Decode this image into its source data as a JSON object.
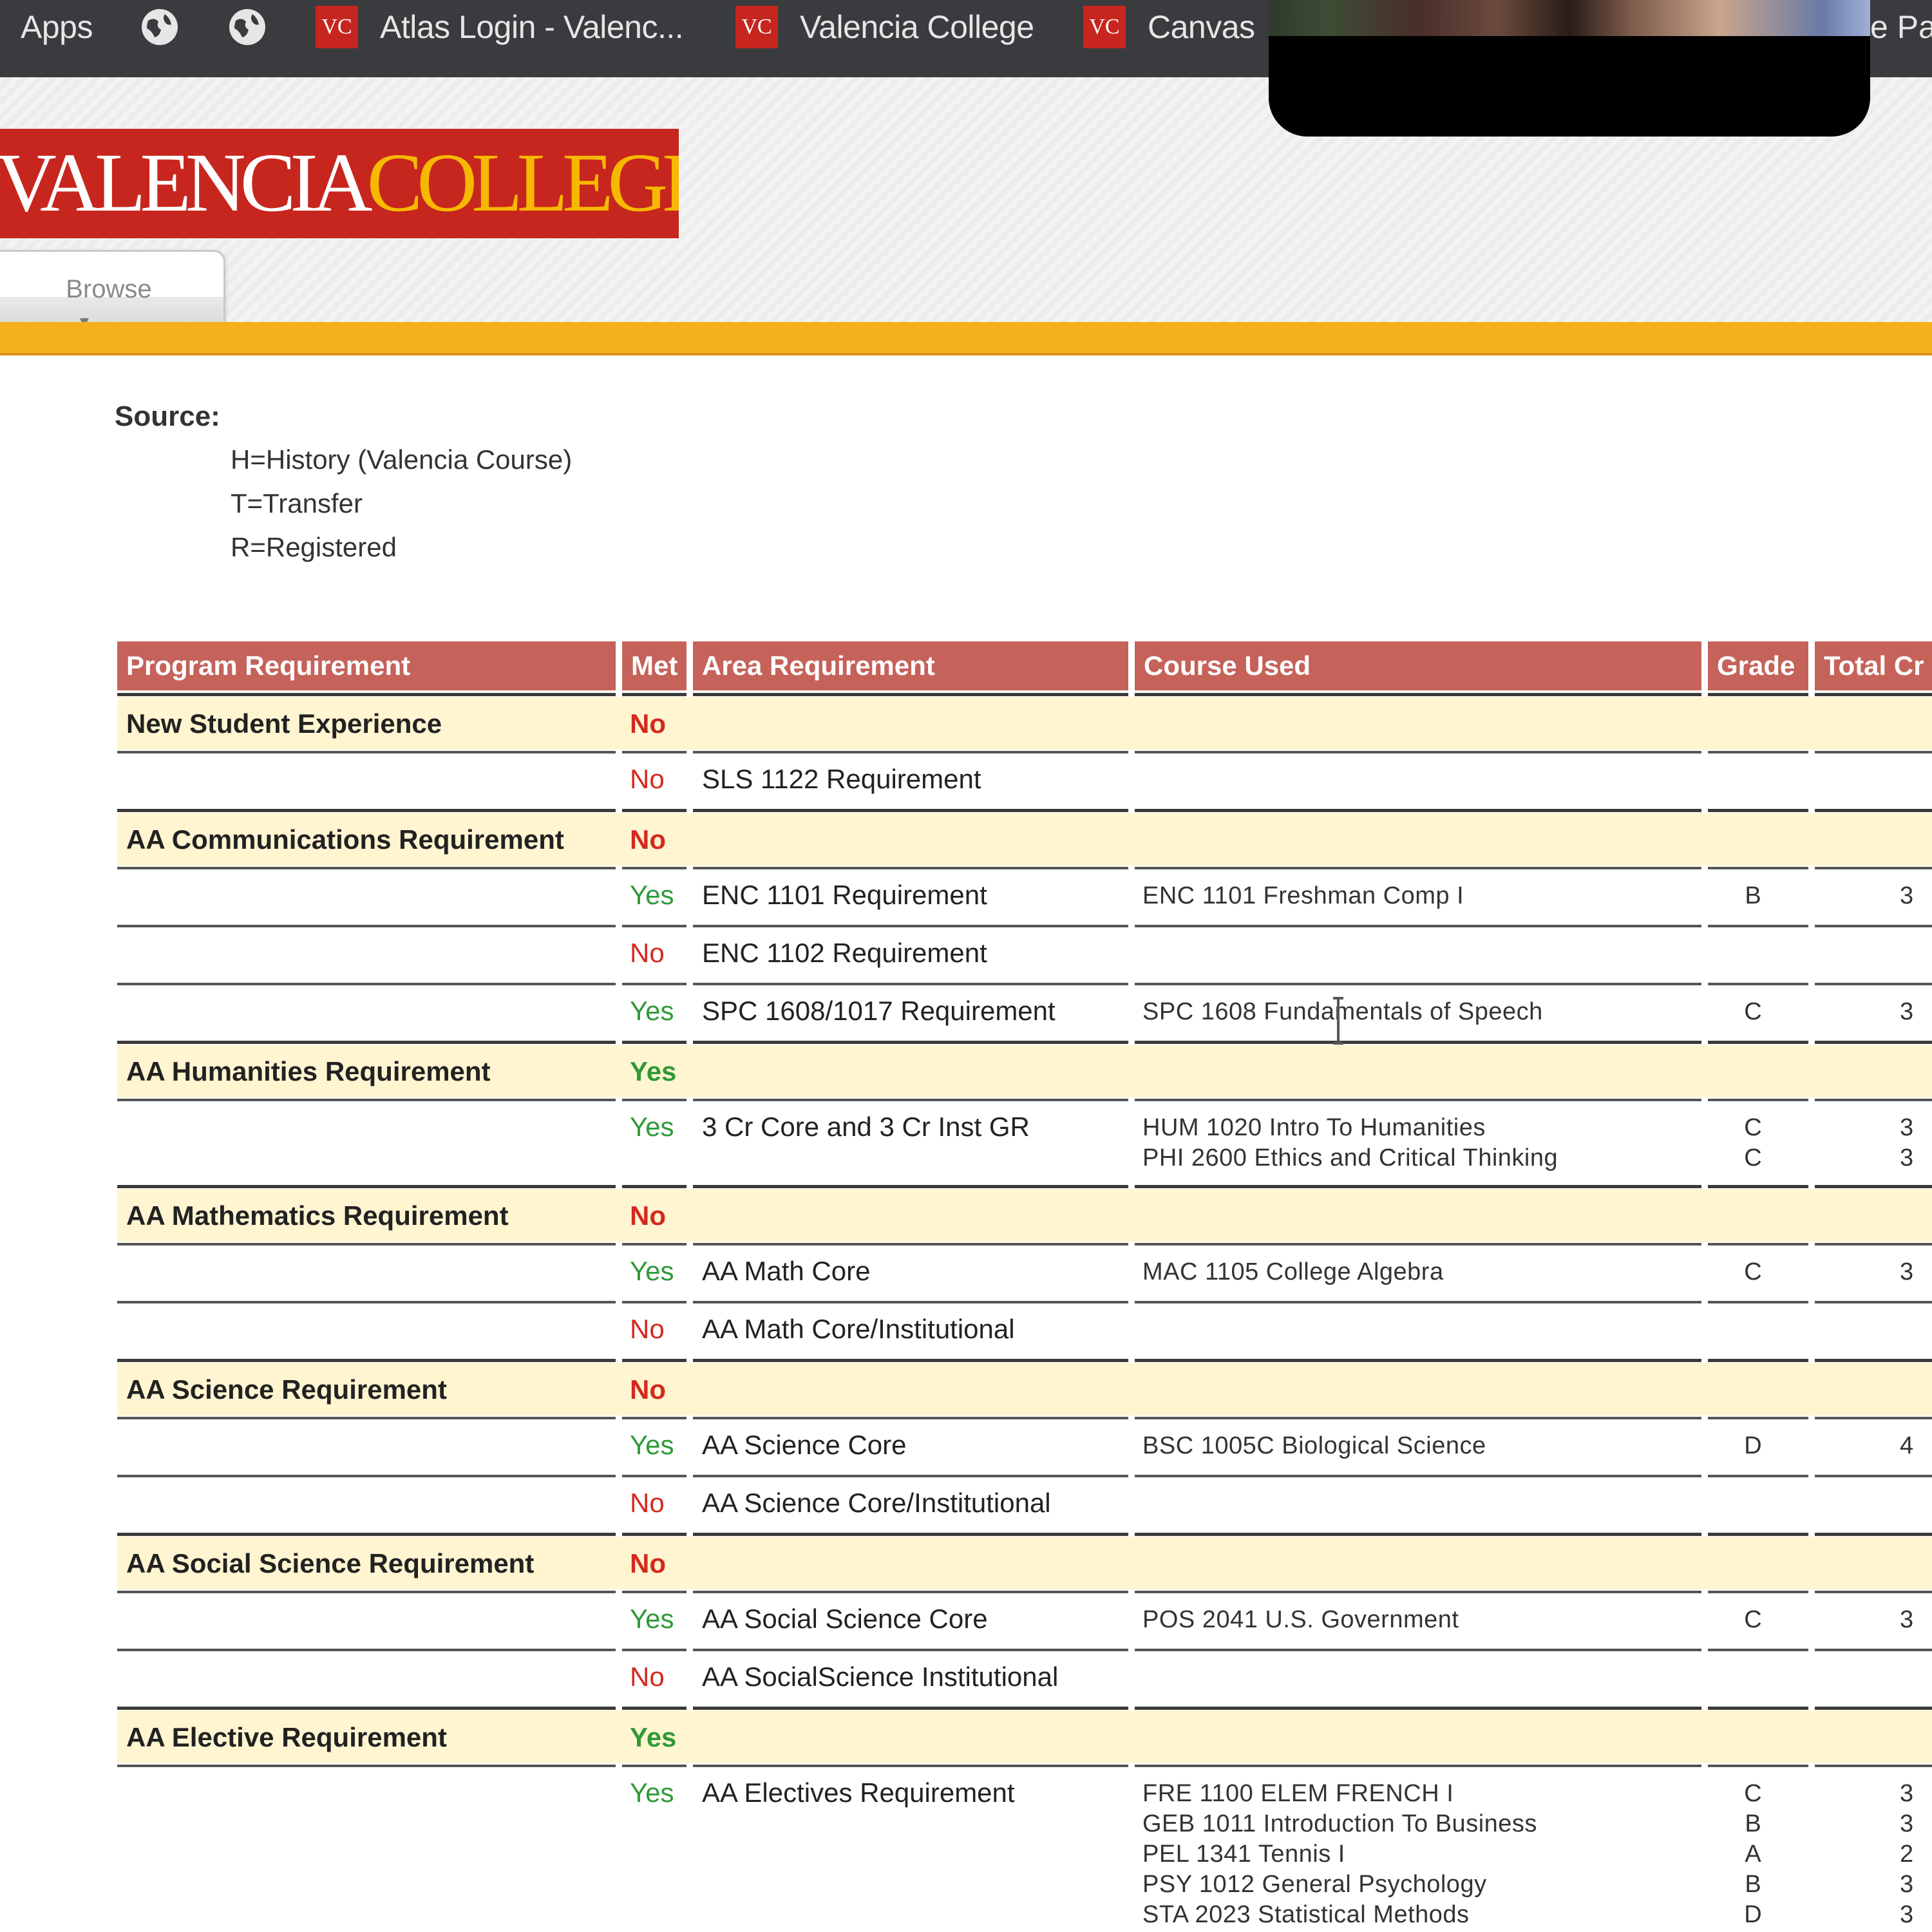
{
  "bookmarks": {
    "apps": "Apps",
    "items": [
      {
        "badge": "VC",
        "label": "Atlas Login - Valenc..."
      },
      {
        "badge": "VC",
        "label": "Valencia College"
      },
      {
        "badge": "VC",
        "label": "Canvas"
      }
    ],
    "overflow_label": "e Pa"
  },
  "header": {
    "logo_part1": "VALENCIA",
    "logo_part2": "COLLEGE",
    "browse_label": "Browse",
    "colors": {
      "brand_red": "#c7261f",
      "brand_gold": "#f4b01d"
    }
  },
  "source": {
    "title": "Source:",
    "items": [
      "H=History (Valencia Course)",
      "T=Transfer",
      "R=Registered"
    ]
  },
  "table": {
    "headers": [
      "Program Requirement",
      "Met",
      "Area Requirement",
      "Course Used",
      "Grade",
      "Total Cr"
    ],
    "groups": [
      {
        "program": "New Student Experience",
        "met": "No",
        "areas": [
          {
            "met": "No",
            "area": "SLS 1122 Requirement",
            "courses": []
          }
        ]
      },
      {
        "program": "AA Communications Requirement",
        "met": "No",
        "areas": [
          {
            "met": "Yes",
            "area": "ENC 1101 Requirement",
            "courses": [
              {
                "text": "ENC  1101  Freshman Comp I",
                "grade": "B",
                "credits": "3"
              }
            ]
          },
          {
            "met": "No",
            "area": "ENC 1102 Requirement",
            "courses": []
          },
          {
            "met": "Yes",
            "area": "SPC 1608/1017 Requirement",
            "courses": [
              {
                "text": "SPC  1608  Fundamentals of Speech",
                "grade": "C",
                "credits": "3"
              }
            ]
          }
        ]
      },
      {
        "program": "AA Humanities Requirement",
        "met": "Yes",
        "areas": [
          {
            "met": "Yes",
            "area": "3 Cr Core and 3 Cr Inst GR",
            "courses": [
              {
                "text": "HUM  1020  Intro To Humanities",
                "grade": "C",
                "credits": "3"
              },
              {
                "text": "PHI  2600  Ethics and Critical Thinking",
                "grade": "C",
                "credits": "3"
              }
            ]
          }
        ]
      },
      {
        "program": "AA Mathematics Requirement",
        "met": "No",
        "areas": [
          {
            "met": "Yes",
            "area": "AA Math Core",
            "courses": [
              {
                "text": "MAC  1105  College Algebra",
                "grade": "C",
                "credits": "3"
              }
            ]
          },
          {
            "met": "No",
            "area": "AA Math Core/Institutional",
            "courses": []
          }
        ]
      },
      {
        "program": "AA Science Requirement",
        "met": "No",
        "areas": [
          {
            "met": "Yes",
            "area": "AA Science Core",
            "courses": [
              {
                "text": "BSC  1005C  Biological Science",
                "grade": "D",
                "credits": "4"
              }
            ]
          },
          {
            "met": "No",
            "area": "AA Science Core/Institutional",
            "courses": []
          }
        ]
      },
      {
        "program": "AA Social Science Requirement",
        "met": "No",
        "areas": [
          {
            "met": "Yes",
            "area": "AA Social Science Core",
            "courses": [
              {
                "text": "POS  2041  U.S. Government",
                "grade": "C",
                "credits": "3"
              }
            ]
          },
          {
            "met": "No",
            "area": "AA SocialScience Institutional",
            "courses": []
          }
        ]
      },
      {
        "program": "AA Elective Requirement",
        "met": "Yes",
        "areas": [
          {
            "met": "Yes",
            "area": "AA Electives Requirement",
            "courses": [
              {
                "text": "FRE  1100  ELEM FRENCH I",
                "grade": "C",
                "credits": "3"
              },
              {
                "text": "GEB  1011  Introduction To Business",
                "grade": "B",
                "credits": "3"
              },
              {
                "text": "PEL  1341  Tennis I",
                "grade": "A",
                "credits": "2"
              },
              {
                "text": "PSY  1012  General Psychology",
                "grade": "B",
                "credits": "3"
              },
              {
                "text": "STA  2023  Statistical Methods",
                "grade": "D",
                "credits": "3"
              }
            ]
          }
        ]
      }
    ]
  }
}
